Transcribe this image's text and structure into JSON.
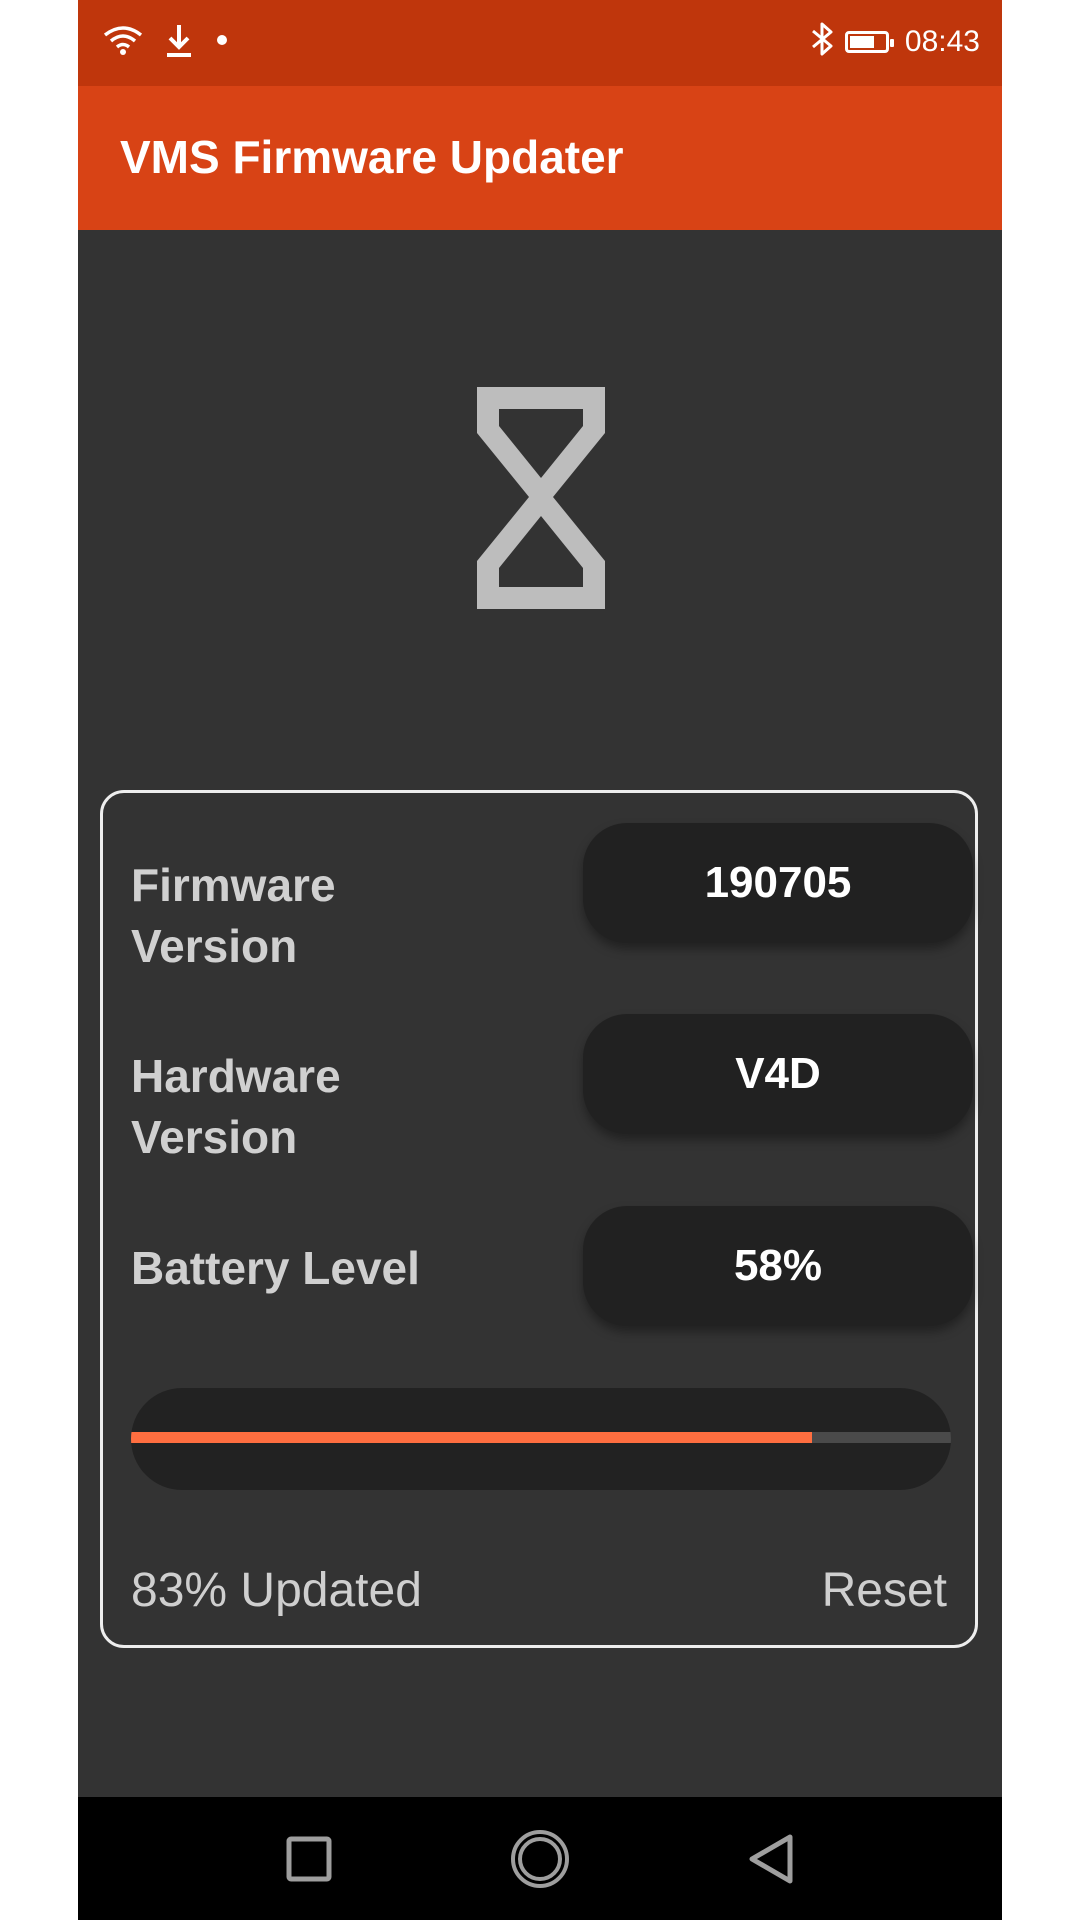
{
  "status_bar": {
    "time": "08:43",
    "icons": [
      "wifi-icon",
      "download-icon",
      "notification-dot-icon",
      "bluetooth-icon",
      "battery-icon"
    ],
    "battery_fraction": 0.7
  },
  "app_bar": {
    "title": "VMS Firmware Updater"
  },
  "hero": {
    "icon": "hourglass-icon"
  },
  "device_info": {
    "rows": [
      {
        "label": "Firmware Version",
        "value": "190705"
      },
      {
        "label": "Hardware Version",
        "value": "V4D"
      },
      {
        "label": "Battery Level",
        "value": "58%"
      }
    ]
  },
  "update": {
    "progress_percent": 83,
    "status_text": "83% Updated",
    "reset_label": "Reset"
  },
  "nav_bar": {
    "buttons": [
      "recents-square-icon",
      "home-circle-icon",
      "back-triangle-icon"
    ]
  },
  "colors": {
    "status_bar": "#BF360C",
    "app_bar": "#D84315",
    "background": "#333333",
    "accent": "#FF6E40",
    "pill": "#212121"
  }
}
